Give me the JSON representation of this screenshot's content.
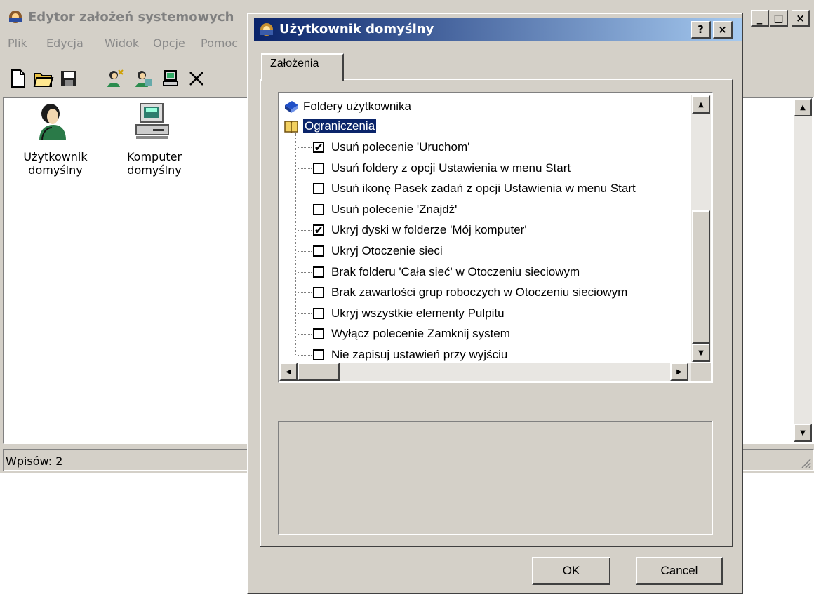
{
  "main_window": {
    "title": "Edytor założeń systemowych",
    "menu": [
      "Plik",
      "Edycja",
      "Widok",
      "Opcje",
      "Pomoc"
    ],
    "controls": {
      "minimize": "_",
      "maximize": "□",
      "close": "×"
    },
    "items": [
      {
        "label_line1": "Użytkownik",
        "label_line2": "domyślny",
        "icon": "user-icon"
      },
      {
        "label_line1": "Komputer",
        "label_line2": "domyślny",
        "icon": "computer-icon"
      }
    ],
    "status": "Wpisów: 2"
  },
  "dialog": {
    "title": "Użytkownik domyślny",
    "help_button": "?",
    "close_button": "×",
    "tab": "Założenia",
    "tree": {
      "folders_label": "Foldery użytkownika",
      "restrictions_label": "Ograniczenia",
      "policies": [
        {
          "label": "Usuń polecenie 'Uruchom'",
          "checked": true
        },
        {
          "label": "Usuń foldery z opcji Ustawienia w menu Start",
          "checked": false
        },
        {
          "label": "Usuń ikonę Pasek zadań z opcji Ustawienia w menu Start",
          "checked": false
        },
        {
          "label": "Usuń polecenie 'Znajdź'",
          "checked": false
        },
        {
          "label": "Ukryj dyski w folderze 'Mój komputer'",
          "checked": true
        },
        {
          "label": "Ukryj Otoczenie sieci",
          "checked": false
        },
        {
          "label": "Brak folderu 'Cała sieć' w Otoczeniu sieciowym",
          "checked": false
        },
        {
          "label": "Brak zawartości grup roboczych w Otoczeniu sieciowym",
          "checked": false
        },
        {
          "label": "Ukryj wszystkie elementy Pulpitu",
          "checked": false
        },
        {
          "label": "Wyłącz polecenie Zamknij system",
          "checked": false
        },
        {
          "label": "Nie zapisuj ustawień przy wyjściu",
          "checked": false
        }
      ]
    },
    "ok": "OK",
    "cancel": "Cancel"
  },
  "check_mark": "✔"
}
